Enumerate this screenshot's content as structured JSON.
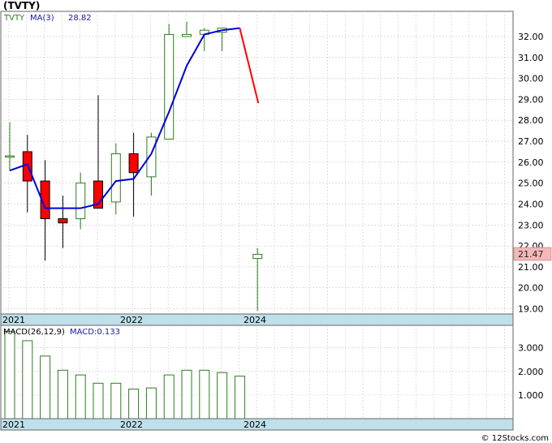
{
  "title": "(TVTY)",
  "watermark": "© 12Stocks.com",
  "colors": {
    "up_candle": "#2e7d1e",
    "down_candle": "#ff0000",
    "ma_up": "#0000dd",
    "ma_down": "#ff0000",
    "grid": "#c8c8c8",
    "axis_strip": "#bfe0ea",
    "price_badge": "#f3b8b8",
    "macd_bar": "#2e7d1e",
    "legend_blue": "#1a1aa8",
    "legend_green": "#2e7d1e"
  },
  "price_panel": {
    "legend": {
      "symbol": "TVTY",
      "ma_label": "MA(3)",
      "ma_value": "28.82"
    },
    "y_ticks": [
      19,
      20,
      21,
      22,
      23,
      24,
      25,
      26,
      27,
      28,
      29,
      30,
      31,
      32
    ],
    "y_tick_labels": [
      "19.00",
      "20.00",
      "21.00",
      "22.00",
      "23.00",
      "24.00",
      "25.00",
      "26.00",
      "27.00",
      "28.00",
      "29.00",
      "30.00",
      "31.00",
      "32.00"
    ],
    "last_price": "21.47",
    "x_labels": [
      "2021",
      "2022",
      "2024"
    ]
  },
  "macd_panel": {
    "legend": {
      "label": "MACD(26,12,9)",
      "value_label": "MACD:0.133"
    },
    "y_ticks": [
      1,
      2,
      3
    ],
    "y_tick_labels": [
      "1.000",
      "2.000",
      "3.000"
    ],
    "x_labels": [
      "2021",
      "2022",
      "2024"
    ]
  },
  "chart_data": {
    "type": "candlestick",
    "title": "(TVTY)",
    "ylim": [
      18.75,
      33.2
    ],
    "candles": [
      {
        "open": 26.3,
        "high": 27.9,
        "low": 25.6,
        "close": 26.3
      },
      {
        "open": 26.5,
        "high": 27.3,
        "low": 23.6,
        "close": 25.1
      },
      {
        "open": 25.1,
        "high": 26.1,
        "low": 21.3,
        "close": 23.3
      },
      {
        "open": 23.3,
        "high": 24.4,
        "low": 21.9,
        "close": 23.1
      },
      {
        "open": 23.3,
        "high": 25.5,
        "low": 22.8,
        "close": 25.0
      },
      {
        "open": 25.1,
        "high": 29.2,
        "low": 23.9,
        "close": 23.8
      },
      {
        "open": 24.1,
        "high": 26.9,
        "low": 23.5,
        "close": 26.4
      },
      {
        "open": 26.4,
        "high": 27.4,
        "low": 23.4,
        "close": 25.5
      },
      {
        "open": 25.3,
        "high": 27.4,
        "low": 24.4,
        "close": 27.2
      },
      {
        "open": 27.1,
        "high": 32.6,
        "low": 27.1,
        "close": 32.1
      },
      {
        "open": 32.0,
        "high": 32.7,
        "low": 32.0,
        "close": 32.1
      },
      {
        "open": 32.1,
        "high": 32.4,
        "low": 31.3,
        "close": 32.3
      },
      {
        "open": 32.2,
        "high": 32.4,
        "low": 31.3,
        "close": 32.4
      },
      {
        "open": 21.4,
        "high": 21.9,
        "low": 18.9,
        "close": 21.6
      }
    ],
    "ma3": [
      25.6,
      25.9,
      23.8,
      23.8,
      23.8,
      24.0,
      25.1,
      25.2,
      26.4,
      28.4,
      30.6,
      32.1,
      32.3,
      32.4,
      28.82
    ],
    "macd": [
      3.7,
      3.3,
      2.65,
      2.05,
      1.85,
      1.5,
      1.5,
      1.25,
      1.3,
      1.85,
      2.05,
      2.05,
      1.95,
      1.8
    ],
    "macd_ylim": [
      0,
      3.95
    ]
  }
}
